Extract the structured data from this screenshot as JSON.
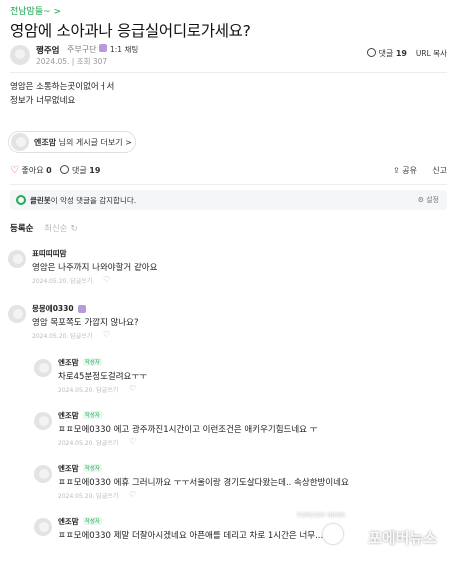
{
  "breadcrumb": "전남맘들~ >",
  "post": {
    "title": "영암에 소아과나 응급실어디로가세요?",
    "author": "행주엄",
    "grade": "주부구단",
    "chat_label": "1:1 채팅",
    "meta": "2024.05. | 조회 307",
    "comment_count_label": "댓글",
    "comment_count": "19",
    "url_copy": "URL 복사",
    "body_lines": [
      "영암은 소통하는곳이없어ㅓ서",
      "정보가 너무없네요"
    ]
  },
  "profile_link": {
    "name": "엔조맘",
    "text": "님의 게시글 더보기 >"
  },
  "actions": {
    "like_label": "좋아요",
    "like_count": "0",
    "comment_label": "댓글",
    "comment_count": "19",
    "share": "공유",
    "report": "신고"
  },
  "cleanbot": {
    "name": "클린봇",
    "text": "이 악성 댓글을 감지합니다.",
    "settings": "설정"
  },
  "sort": {
    "active": "등록순",
    "inactive": "최신순"
  },
  "comments": [
    {
      "author": "표띠띠띠맘",
      "badge": "",
      "text": "영암은 나주까지 나와야할거 같아요",
      "meta": "2024.05.20. 답글쓰기"
    },
    {
      "author": "몽몽에0330",
      "badge": "",
      "text": "영암 목포쪽도 가깝지 않나요?",
      "meta": "2024.05.20. 답글쓰기"
    },
    {
      "author": "엔조맘",
      "badge": "작성자",
      "text": "차로45분정도걸려요ㅜㅜ",
      "meta": "2024.05.20. 답글쓰기"
    },
    {
      "author": "",
      "badge": "작성자",
      "text": "ㅍㅍ모에0330 에고 광주까진1시간이고 이런조건은 애키우기힘드네요 ㅜ",
      "meta": "2024.05.20. 답글쓰기"
    },
    {
      "author": "",
      "badge": "",
      "text": "ㅍㅍ모에0330 에휴 그러니까요 ㅜㅜ서울이랑 경기도살다왔는데.. 속상한방이네요",
      "meta": "2024.05.20. 답글쓰기"
    },
    {
      "author": "엔조맘",
      "badge": "작성자",
      "text": "ㅍㅍ모에0330 제말 더잘아시겠네요 아픈애를 데리고 차로 1시간은 너무...",
      "meta": ""
    }
  ],
  "watermark": {
    "name": "포에버뉴스",
    "sub": "FOREVER NEWS"
  }
}
